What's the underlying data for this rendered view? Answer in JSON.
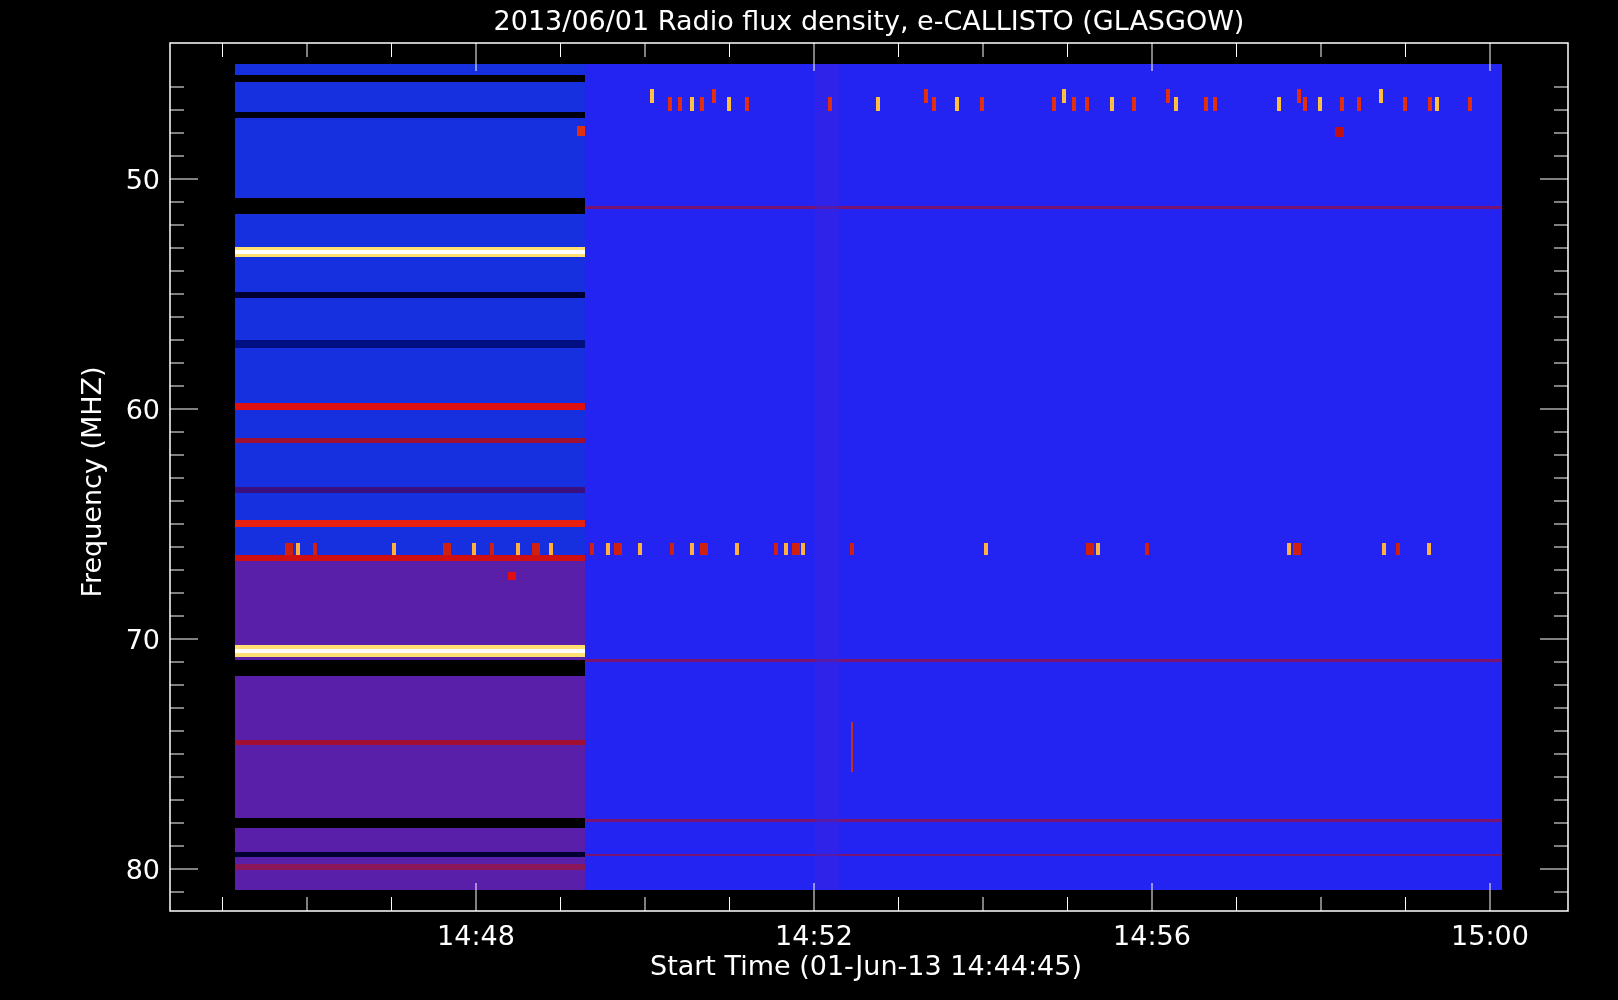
{
  "title": "2013/06/01  Radio flux density, e-CALLISTO (GLASGOW)",
  "y_axis": {
    "label": "Frequency (MHZ)",
    "ticks": [
      "50",
      "60",
      "70",
      "80"
    ]
  },
  "x_axis": {
    "label": "Start Time (01-Jun-13 14:44:45)",
    "ticks": [
      "14:48",
      "14:52",
      "14:56",
      "15:00"
    ]
  }
}
